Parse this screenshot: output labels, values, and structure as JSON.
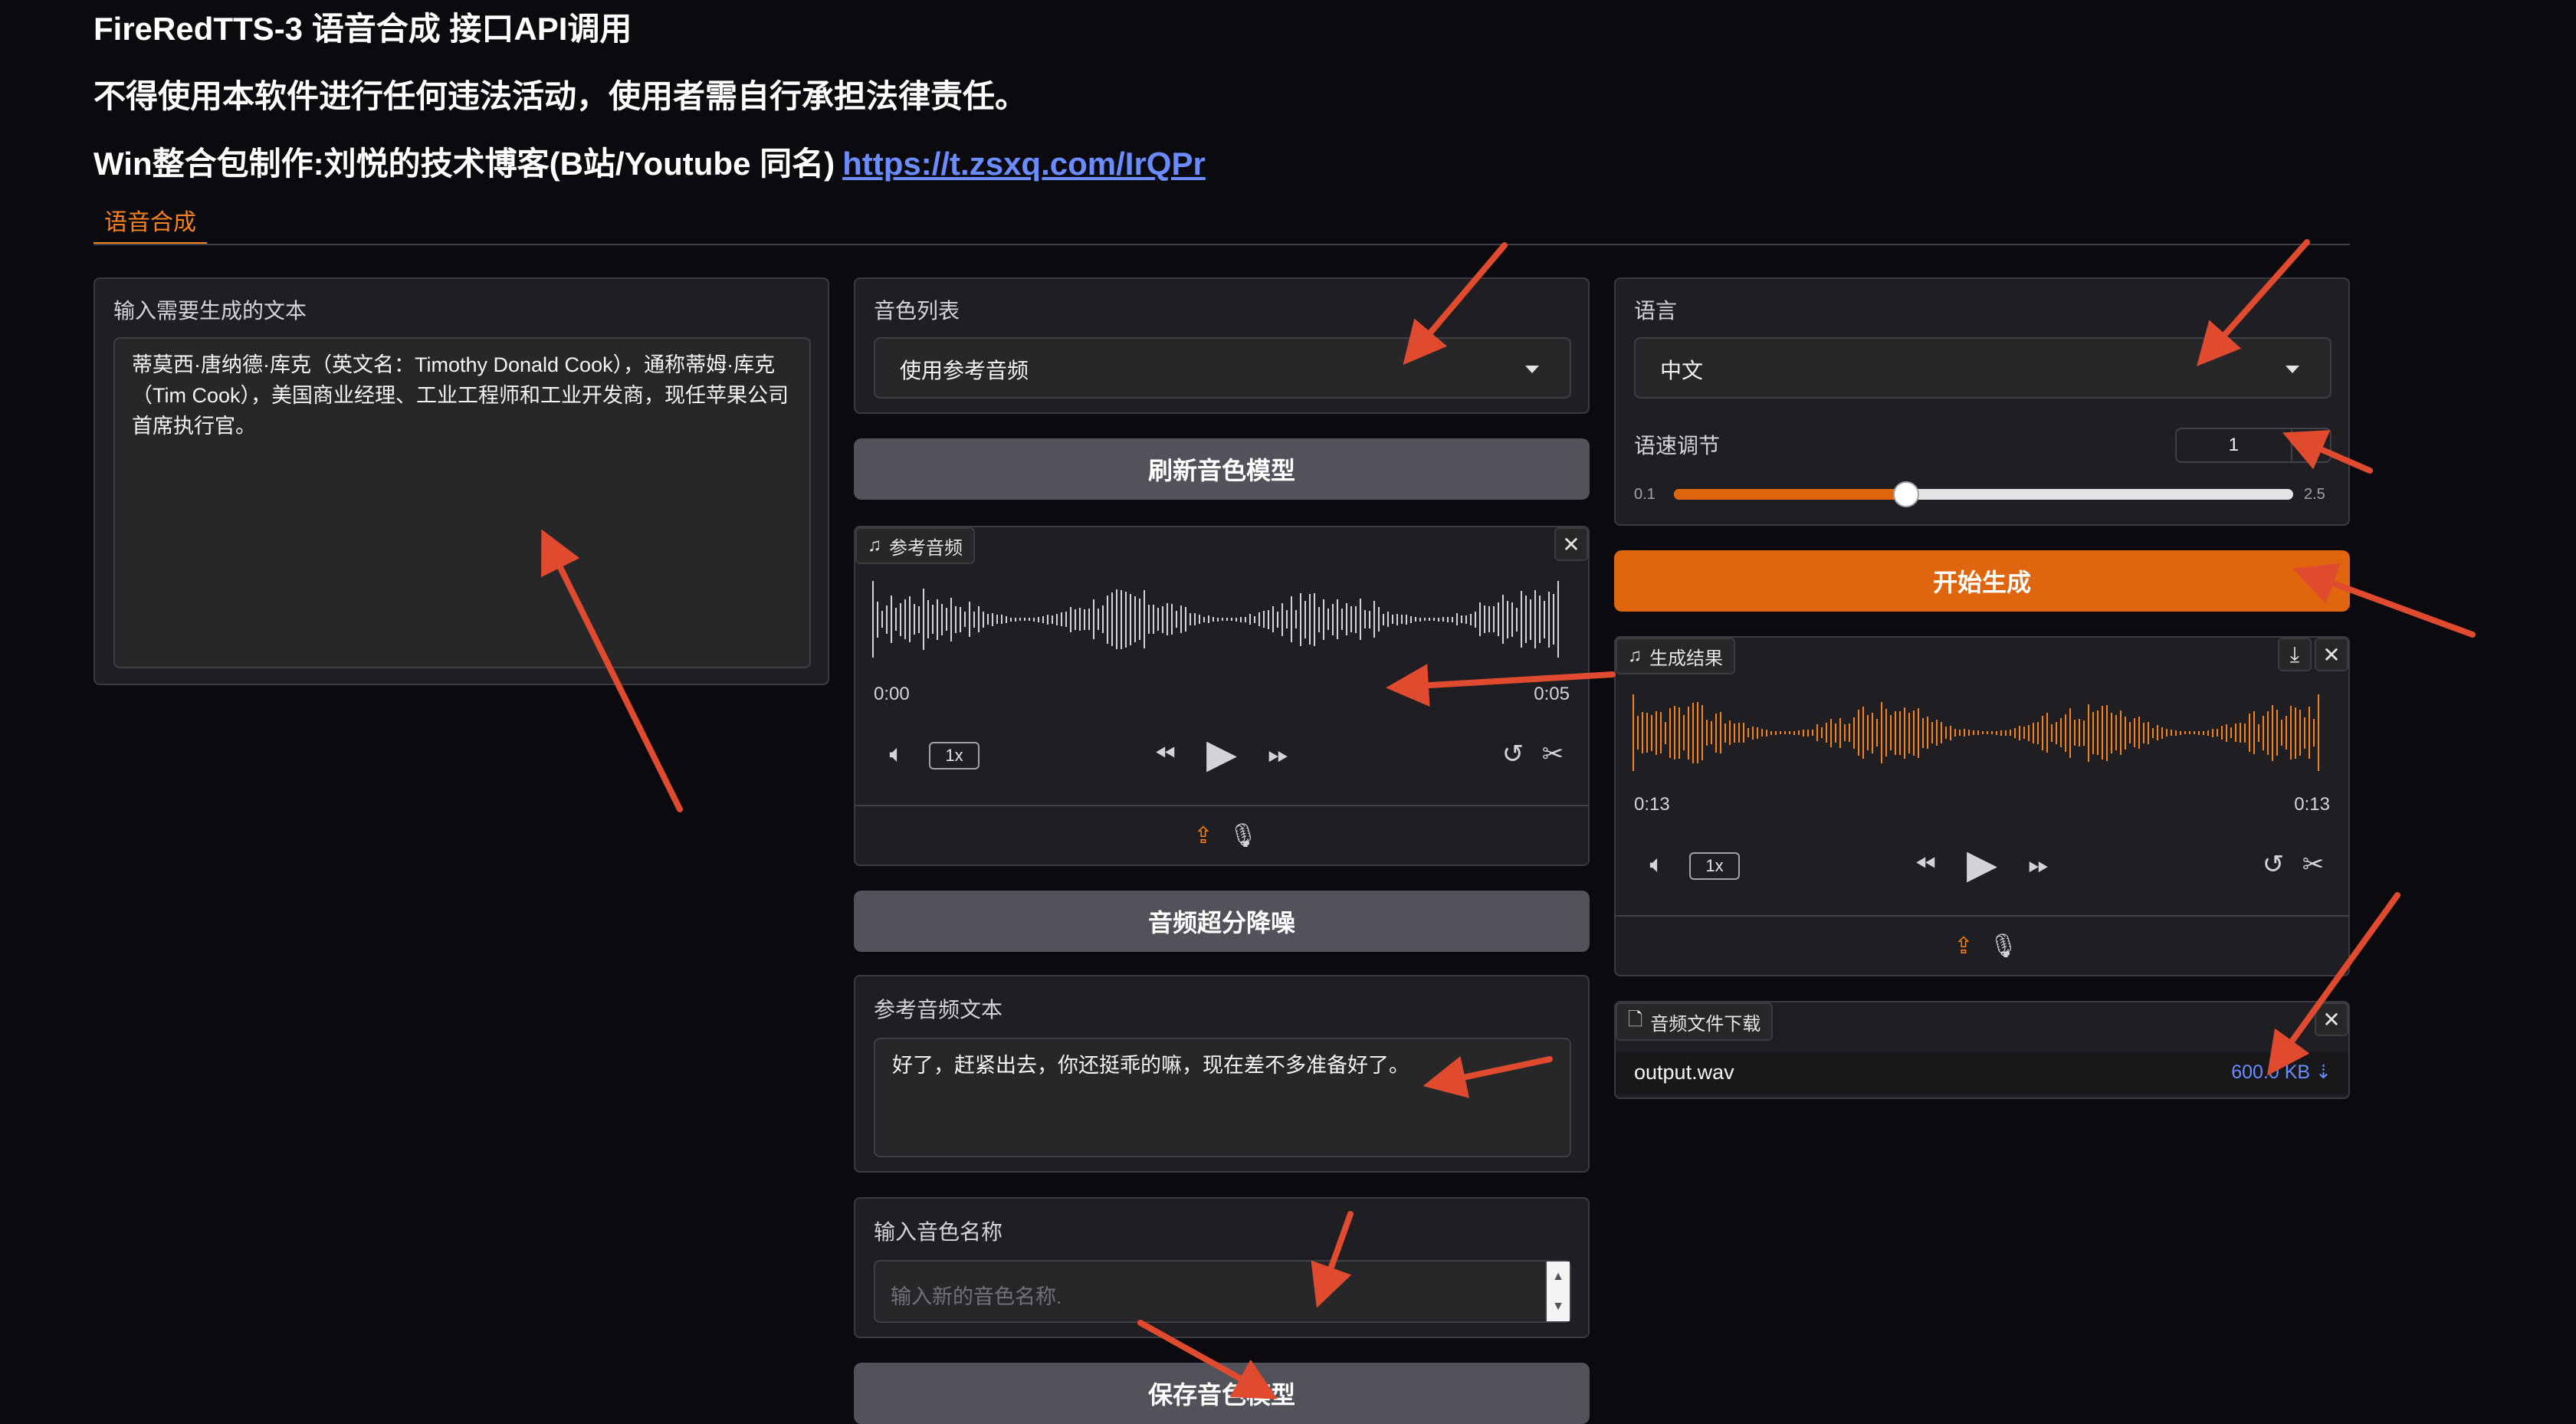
{
  "header": {
    "title": "FireRedTTS-3 语音合成 接口API调用",
    "warning": "不得使用本软件进行任何违法活动，使用者需自行承担法律责任。",
    "credit": "Win整合包制作:刘悦的技术博客(B站/Youtube 同名)",
    "credit_link": "https://t.zsxq.com/IrQPr"
  },
  "tabs": [
    {
      "label": "语音合成",
      "active": true
    }
  ],
  "text_input": {
    "label": "输入需要生成的文本",
    "value": "蒂莫西·唐纳德·库克（英文名：Timothy Donald Cook），通称蒂姆·库克（Tim Cook），美国商业经理、工业工程师和工业开发商，现任苹果公司首席执行官。"
  },
  "voice_list": {
    "label": "音色列表",
    "selected": "使用参考音频"
  },
  "refresh_button": "刷新音色模型",
  "ref_audio": {
    "label": "参考音频",
    "time_start": "0:00",
    "time_end": "0:05",
    "speed": "1x"
  },
  "denoise_button": "音频超分降噪",
  "ref_text": {
    "label": "参考音频文本",
    "value": "好了，赶紧出去，你还挺乖的嘛，现在差不多准备好了。"
  },
  "voice_name": {
    "label": "输入音色名称",
    "placeholder": "输入新的音色名称."
  },
  "save_button": "保存音色模型",
  "language": {
    "label": "语言",
    "selected": "中文"
  },
  "speed_control": {
    "label": "语速调节",
    "value": "1",
    "min_label": "0.1",
    "max_label": "2.5",
    "min": 0.1,
    "max": 2.5,
    "current": 1
  },
  "generate_button": "开始生成",
  "result_audio": {
    "label": "生成结果",
    "time_start": "0:13",
    "time_end": "0:13",
    "speed": "1x"
  },
  "download": {
    "label": "音频文件下载",
    "filename": "output.wav",
    "size": "600.0 KB ⇣"
  },
  "colors": {
    "accent": "#e0650f",
    "wave_ref": "#d4d4d8",
    "wave_result": "#f58220",
    "link": "#6b8cff",
    "annotation_arrow": "#e04a2f"
  }
}
